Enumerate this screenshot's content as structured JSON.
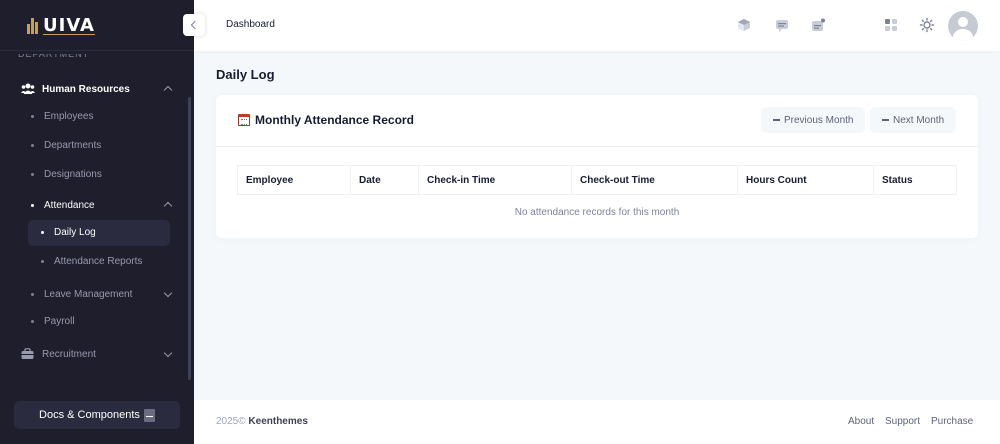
{
  "app": {
    "logo_text": "UIVA",
    "accent": "#c8a050"
  },
  "sidebar": {
    "section_label": "Department",
    "items": [
      {
        "label": "Human Resources",
        "icon": "users-icon",
        "expanded": true
      },
      {
        "label": "Employees"
      },
      {
        "label": "Departments"
      },
      {
        "label": "Designations"
      },
      {
        "label": "Attendance",
        "expanded": true
      },
      {
        "label": "Daily Log",
        "active": true
      },
      {
        "label": "Attendance Reports"
      },
      {
        "label": "Leave Management",
        "expanded": false
      },
      {
        "label": "Payroll"
      },
      {
        "label": "Recruitment",
        "icon": "briefcase-icon",
        "expanded": false
      }
    ],
    "docs_button": "Docs & Components"
  },
  "header": {
    "breadcrumb": "Dashboard",
    "icons": [
      "cube-icon",
      "chat-icon",
      "notification-icon",
      "apps-icon",
      "theme-sun-icon"
    ],
    "avatar": "avatar"
  },
  "main": {
    "page_title": "Daily Log",
    "card": {
      "title": "Monthly Attendance Record",
      "prev_button": "Previous Month",
      "next_button": "Next Month",
      "columns": [
        "Employee",
        "Date",
        "Check-in Time",
        "Check-out Time",
        "Hours Count",
        "Status"
      ],
      "empty_message": "No attendance records for this month"
    }
  },
  "footer": {
    "year": "2025©",
    "brand": "Keenthemes",
    "links": [
      "About",
      "Support",
      "Purchase"
    ]
  }
}
